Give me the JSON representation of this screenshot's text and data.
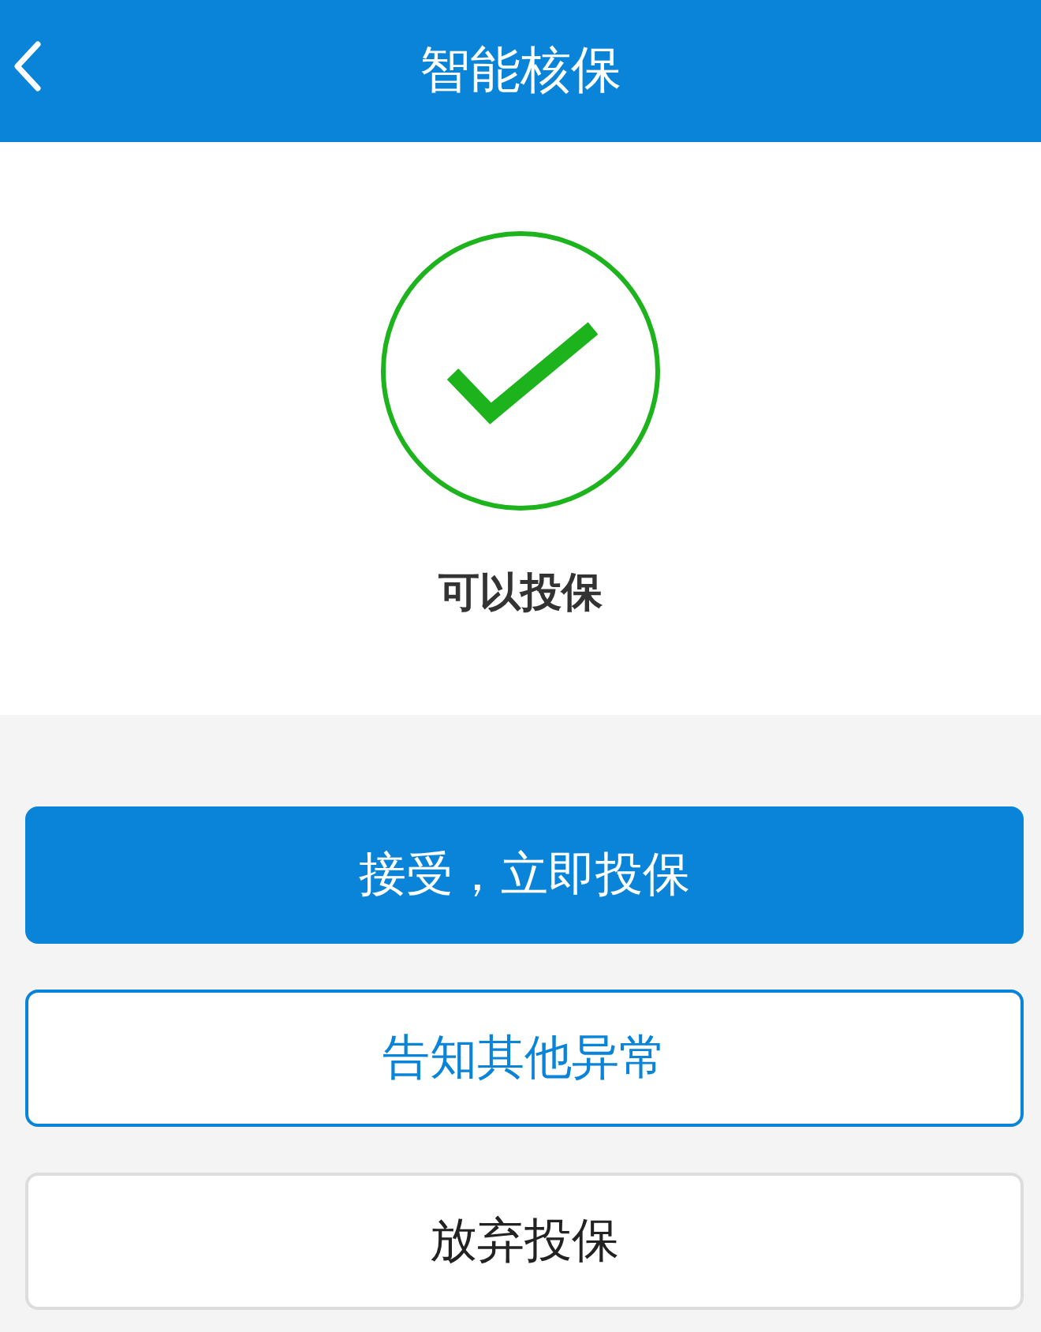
{
  "header": {
    "title": "智能核保"
  },
  "result": {
    "message": "可以投保"
  },
  "buttons": [
    {
      "label": "接受，立即投保",
      "kind": "primary"
    },
    {
      "label": "告知其他异常",
      "kind": "outline"
    },
    {
      "label": "放弃投保",
      "kind": "plain"
    }
  ]
}
